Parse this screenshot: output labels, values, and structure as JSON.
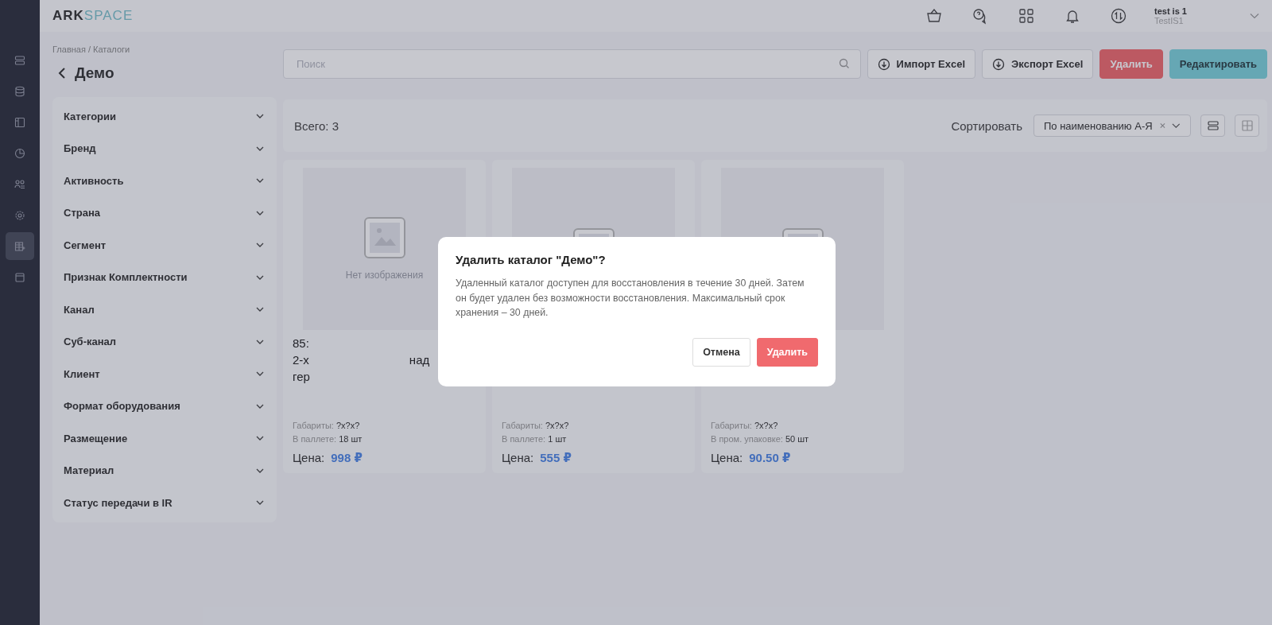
{
  "header": {
    "logo_dark": "ARK",
    "logo_light": "SPACE",
    "user_name": "test is 1",
    "user_login": "TestIS1"
  },
  "sidebar": {
    "items": [
      {
        "selected": false
      },
      {
        "selected": false
      },
      {
        "selected": false
      },
      {
        "selected": false
      },
      {
        "selected": false
      },
      {
        "selected": false
      },
      {
        "selected": true
      },
      {
        "selected": false
      }
    ]
  },
  "breadcrumb": "Главная / Каталоги",
  "page_title": "Демо",
  "search": {
    "placeholder": "Поиск"
  },
  "actions": [
    {
      "label": "Импорт Excel",
      "kind": "import"
    },
    {
      "label": "Экспорт Excel",
      "kind": "export"
    },
    {
      "label": "Удалить",
      "kind": "danger"
    },
    {
      "label": "Редактировать",
      "kind": "primary"
    }
  ],
  "filters": [
    {
      "label": "Категории",
      "expanded": false
    },
    {
      "label": "Бренд",
      "expanded": false
    },
    {
      "label": "Активность",
      "expanded": false
    },
    {
      "label": "Страна",
      "expanded": false
    },
    {
      "label": "Сегмент",
      "expanded": false
    },
    {
      "label": "Признак Комплектности",
      "expanded": false
    },
    {
      "label": "Канал",
      "expanded": false
    },
    {
      "label": "Суб-канал",
      "expanded": false
    },
    {
      "label": "Клиент",
      "expanded": false
    },
    {
      "label": "Формат оборудования",
      "expanded": false
    },
    {
      "label": "Размещение",
      "expanded": false
    },
    {
      "label": "Материал",
      "expanded": false
    },
    {
      "label": "Статус передачи в IR",
      "expanded": false
    }
  ],
  "toolbar": {
    "total": "Всего: 3",
    "sort_label": "Сортировать",
    "sort_value": "По наименованию А-Я",
    "view_modes": [
      {
        "kind": "list",
        "selected": false
      },
      {
        "kind": "grid",
        "selected": false
      }
    ]
  },
  "cards": [
    {
      "no_image": "Нет изображения",
      "title_lines": [
        [
          "85:"
        ],
        [
          "2-х",
          "над"
        ],
        [
          "гер"
        ]
      ],
      "dims_label": "Габариты:",
      "dims": "?x?x?",
      "qty_label": "В паллете:",
      "qty": "18 шт",
      "price_label": "Цена:",
      "price": "998 ₽"
    },
    {
      "dims_label": "Габариты:",
      "dims": "?x?x?",
      "qty_label": "В паллете:",
      "qty": "1 шт",
      "price_label": "Цена:",
      "price": "555 ₽"
    },
    {
      "dims_label": "Габариты:",
      "dims": "?x?x?",
      "qty_label": "В пром. упаковке:",
      "qty": "50 шт",
      "price_label": "Цена:",
      "price": "90.50 ₽"
    }
  ],
  "dialog": {
    "title": "Удалить каталог \"Демо\"?",
    "text": "Удаленный каталог доступен для восстановления в течение 30 дней. Затем он будет удален без возможности восстановления. Максимальный срок хранения – 30 дней.",
    "buttons": [
      {
        "label": "Отмена",
        "kind": "secondary"
      },
      {
        "label": "Удалить",
        "kind": "danger"
      }
    ]
  }
}
